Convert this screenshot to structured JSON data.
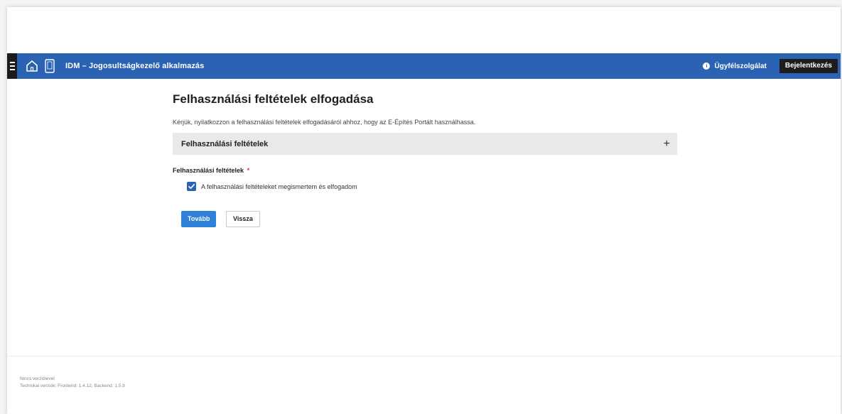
{
  "colors": {
    "header_bg": "#2a63b3",
    "primary_button": "#2f80d8",
    "accordion_bg": "#e9e9e9",
    "required_mark": "#d33333"
  },
  "header": {
    "menu_icon": "hamburger-icon",
    "home_icon": "home-icon",
    "app_icon": "tablet-icon",
    "title": "IDM – Jogosultságkezelő alkalmazás",
    "support_icon": "info-icon",
    "support_label": "Ügyfélszolgálat",
    "login_label": "Bejelentkezés"
  },
  "main": {
    "title": "Felhasználási feltételek elfogadása",
    "intro": "Kérjük, nyilatkozzon a felhasználási feltételek elfogadásáról ahhoz, hogy az E-Építés Portált használhassa.",
    "accordion": {
      "label": "Felhasználási feltételek",
      "expand_icon": "+"
    },
    "field": {
      "label": "Felhasználási feltételek",
      "required_mark": "*",
      "checkbox_label": "A felhasználási feltételeket megismertem és elfogadom",
      "checked": true
    },
    "buttons": {
      "next": "Tovább",
      "back": "Vissza"
    }
  },
  "footer": {
    "line1": "Nincs verziólevél",
    "line2": "Technikai verziók: Frontend: 1.4.12, Backend: 1.5.9"
  }
}
